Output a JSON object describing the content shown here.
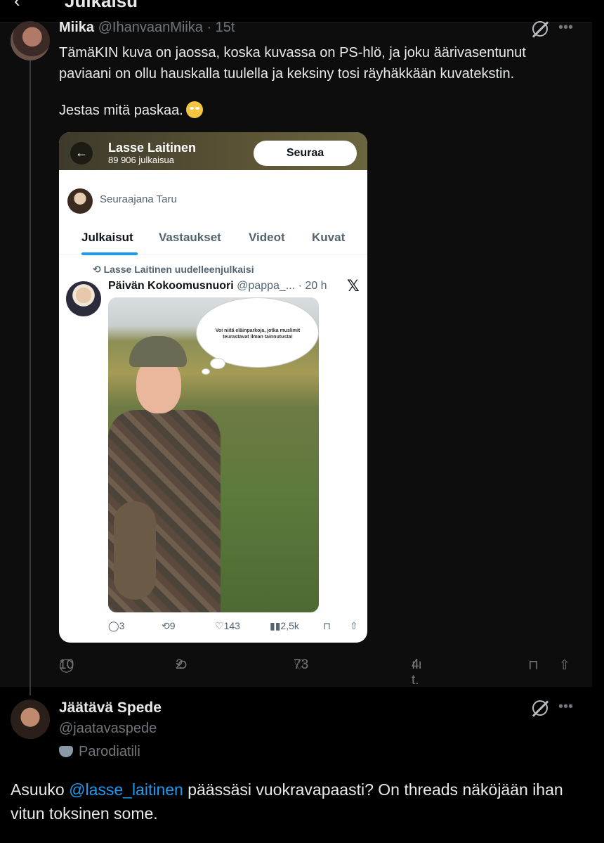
{
  "header": {
    "back_icon": "arrow-left-icon",
    "title": "Julkaisu"
  },
  "post1": {
    "name": "Miika",
    "handle": "@IhanvaanMiika",
    "separator": "·",
    "time": "15t",
    "text": "TämäKIN kuva on jaossa, koska kuvassa on PS-hlö, ja joku äärivasentunut paviaani on ollu hauskalla tuulella ja keksiny tosi räyhäkkään kuvatekstin.",
    "text2": "Jestas mitä paskaa.",
    "actions": {
      "replies": "10",
      "reposts": "2",
      "likes": "73",
      "views": "4 t."
    }
  },
  "embedded": {
    "profile_name": "Lasse Laitinen",
    "post_count": "89 906 julkaisua",
    "follow_label": "Seuraa",
    "follower_text": "Seuraajana Taru",
    "tabs": [
      "Julkaisut",
      "Vastaukset",
      "Videot",
      "Kuvat"
    ],
    "repost_text": "Lasse Laitinen uudelleenjulkaisi",
    "inner_name": "Päivän Kokoomusnuori",
    "inner_handle": "@pappa_...",
    "inner_time": "· 20 h",
    "bubble_text": "Voi niitä eläinparkoja, jotka muslimit teurastavat ilman tainnutusta!",
    "actions": {
      "replies": "3",
      "reposts": "9",
      "likes": "143",
      "views": "2,5k"
    }
  },
  "post2": {
    "name": "Jäätävä Spede",
    "handle": "@jaatavaspede",
    "parody": "Parodiatili",
    "text_before": "Asuuko ",
    "mention": "@lasse_laitinen",
    "text_after": " päässäsi vuokravapaasti? On threads näköjään ihan vitun toksinen some."
  }
}
